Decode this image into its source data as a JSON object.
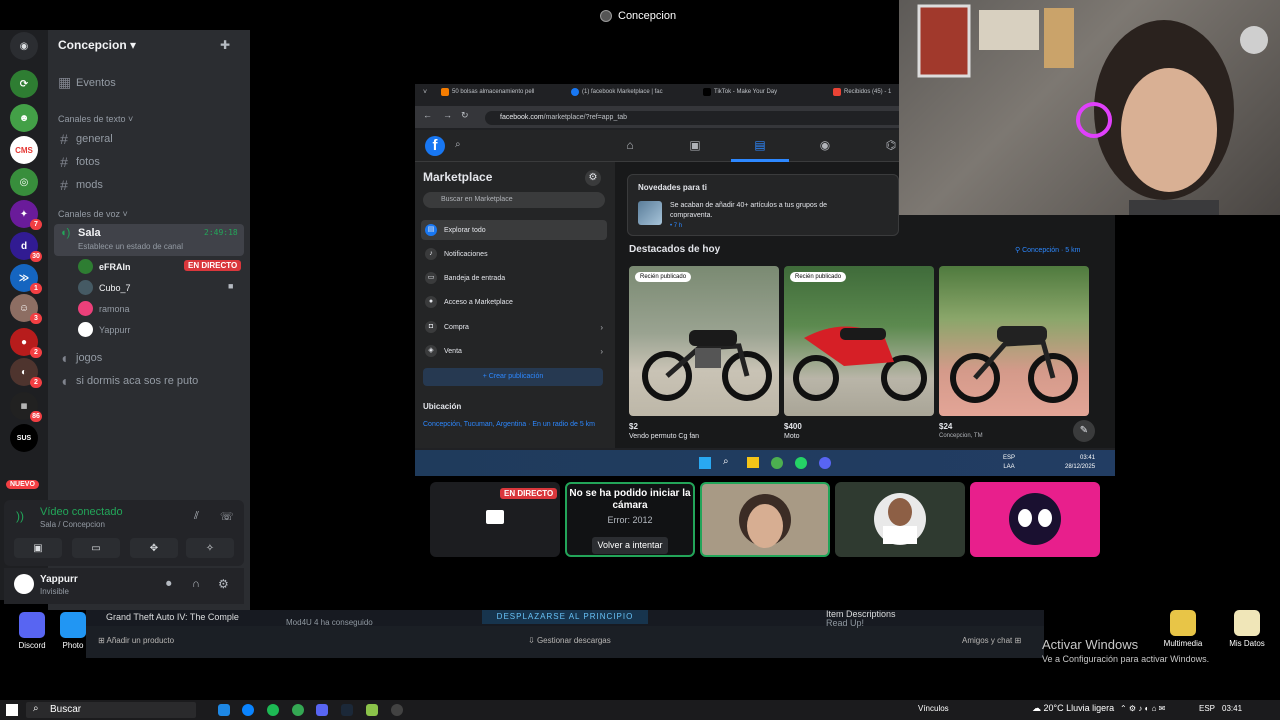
{
  "window": {
    "title": "Concepcion"
  },
  "discord": {
    "server_name": "Concepcion",
    "events_label": "Eventos",
    "text_category": "Canales de texto",
    "text_channels": [
      "general",
      "fotos",
      "mods"
    ],
    "voice_category": "Canales de voz",
    "voice_channel": {
      "name": "Sala",
      "time": "2:49:18",
      "status": "Establece un estado de canal"
    },
    "voice_users": [
      {
        "name": "eFRAIn",
        "badge": "EN DIRECTO"
      },
      {
        "name": "Cubo_7"
      },
      {
        "name": "ramona"
      },
      {
        "name": "Yappurr"
      }
    ],
    "other_voice_channels": [
      "jogos",
      "si dormis aca sos re puto"
    ],
    "rail_badges": [
      "7",
      "30",
      "1",
      "3",
      "2",
      "2",
      "86"
    ],
    "nuevo_label": "NUEVO",
    "voice_panel": {
      "title": "Vídeo conectado",
      "subtitle": "Sala / Concepcion"
    },
    "user": {
      "name": "Yappurr",
      "status": "Invisible"
    }
  },
  "browser": {
    "tabs": [
      "50 bolsas almacenamiento pell",
      "(1) facebook Marketplace | fac",
      "TikTok - Make Your Day",
      "Recibidos (45) - 1"
    ],
    "url_host": "facebook.com",
    "url_path": "/marketplace/?ref=app_tab"
  },
  "marketplace": {
    "title": "Marketplace",
    "search_placeholder": "Buscar en Marketplace",
    "menu": [
      {
        "label": "Explorar todo"
      },
      {
        "label": "Notificaciones"
      },
      {
        "label": "Bandeja de entrada"
      },
      {
        "label": "Acceso a Marketplace"
      },
      {
        "label": "Compra"
      },
      {
        "label": "Venta"
      }
    ],
    "create_label": "+ Crear publicación",
    "location_title": "Ubicación",
    "location_text": "Concepción, Tucuman, Argentina · En un radio de 5 km",
    "news": {
      "title": "Novedades para ti",
      "text": "Se acaban de añadir 40+ artículos a tus grupos de compraventa.",
      "time": "• 7 h"
    },
    "today_title": "Destacados de hoy",
    "today_location": "Concepción · 5 km",
    "listings": [
      {
        "tag": "Recién publicado",
        "price": "$2",
        "desc": "Vendo permuto Cg fan"
      },
      {
        "tag": "Recién publicado",
        "price": "$400",
        "desc": "Moto"
      },
      {
        "tag": "",
        "price": "$24",
        "desc": "Concepcion, TM"
      }
    ]
  },
  "inner_taskbar": {
    "lang": "ESP\nLAA",
    "time": "03:41",
    "date": "28/12/2025"
  },
  "call": {
    "live_badge": "EN DIRECTO",
    "nocam_title": "No se ha podido iniciar la cámara",
    "nocam_error": "Error: 2012",
    "retry_label": "Volver a intentar"
  },
  "steam": {
    "game": "Grand Theft Auto IV: The Comple",
    "mod": "Mod4U 4 ha conseguido",
    "scroll_label": "DESPLAZARSE AL PRINCIPIO",
    "items": "Item Descriptions",
    "items_sub": "Read Up!",
    "add_product": "Añadir un producto",
    "downloads": "Gestionar descargas",
    "friends": "Amigos y chat"
  },
  "desktop": {
    "icons": [
      "Discord",
      "Photo",
      "Multimedia",
      "Mis Datos"
    ],
    "activate_title": "Activar Windows",
    "activate_sub": "Ve a Configuración para activar Windows."
  },
  "taskbar": {
    "search_label": "Buscar",
    "links": "Vínculos",
    "weather": "20°C  Lluvia ligera",
    "lang": "ESP",
    "time": "03:41"
  }
}
